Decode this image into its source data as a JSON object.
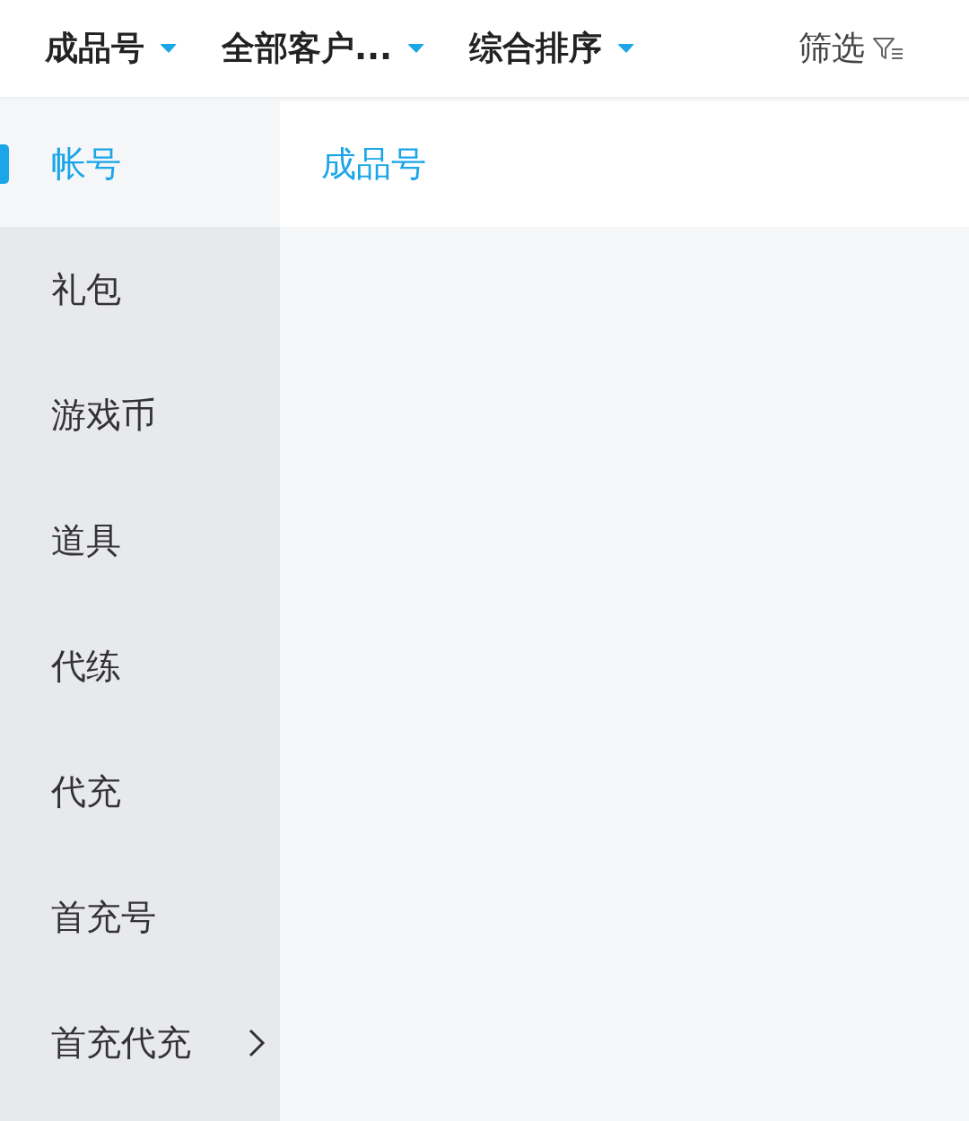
{
  "header": {
    "dropdowns": [
      {
        "label": "成品号"
      },
      {
        "label": "全部客户..."
      },
      {
        "label": "综合排序"
      }
    ],
    "filter": {
      "label": "筛选"
    }
  },
  "sidebar": {
    "items": [
      {
        "label": "帐号",
        "selected": true,
        "expandable": false
      },
      {
        "label": "礼包",
        "selected": false,
        "expandable": false
      },
      {
        "label": "游戏币",
        "selected": false,
        "expandable": false
      },
      {
        "label": "道具",
        "selected": false,
        "expandable": false
      },
      {
        "label": "代练",
        "selected": false,
        "expandable": false
      },
      {
        "label": "代充",
        "selected": false,
        "expandable": false
      },
      {
        "label": "首充号",
        "selected": false,
        "expandable": false
      },
      {
        "label": "首充代充",
        "selected": false,
        "expandable": true
      }
    ]
  },
  "content": {
    "subcategories": [
      {
        "label": "成品号",
        "selected": true
      }
    ]
  }
}
